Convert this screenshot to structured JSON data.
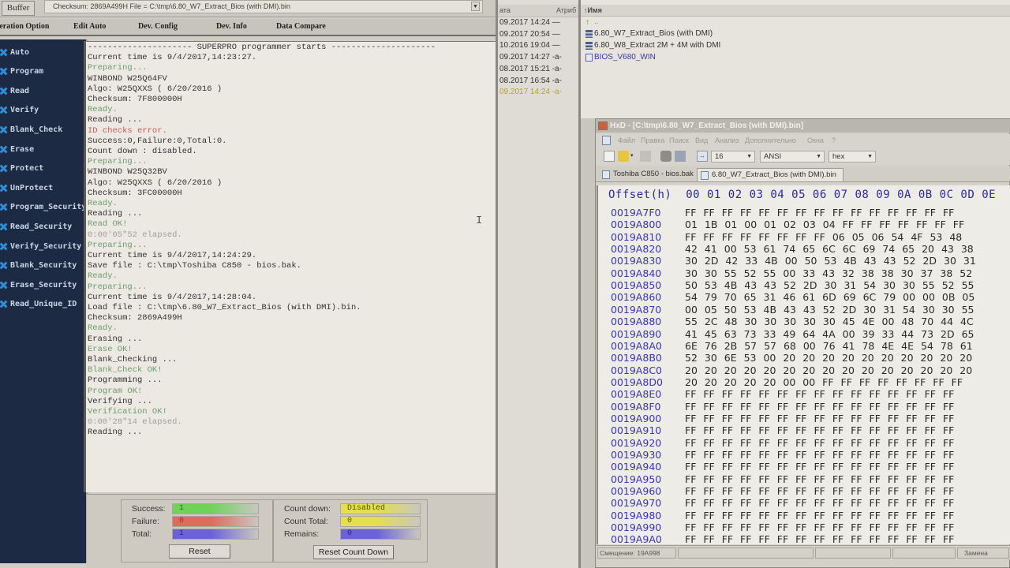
{
  "superpro": {
    "buffer_label": "Buffer",
    "info_combo": "Checksum: 2869A499H    File = C:\\tmp\\6.80_W7_Extract_Bios (with DMI).bin",
    "menu": [
      "Operation Option",
      "Edit Auto",
      "Dev. Config",
      "Dev. Info",
      "Data Compare"
    ],
    "operations": [
      "Auto",
      "Program",
      "Read",
      "Verify",
      "Blank_Check",
      "Erase",
      "Protect",
      "UnProtect",
      "Program_Security",
      "Read_Security",
      "Verify_Security",
      "Blank_Security",
      "Erase_Security",
      "Read_Unique_ID"
    ],
    "log": [
      {
        "text": "--------------------- SUPERPRO programmer starts ---------------------",
        "kind": "normal"
      },
      {
        "text": "Current time is 9/4/2017,14:23:27.",
        "kind": "normal"
      },
      {
        "text": "Preparing...",
        "kind": "ok"
      },
      {
        "text": "WINBOND W25Q64FV",
        "kind": "normal"
      },
      {
        "text": "Algo: W25QXXS   ( 6/20/2016 )",
        "kind": "normal"
      },
      {
        "text": "Checksum: 7F800000H",
        "kind": "normal"
      },
      {
        "text": "Ready.",
        "kind": "ok"
      },
      {
        "text": "Reading ...",
        "kind": "normal"
      },
      {
        "text": "ID checks error.",
        "kind": "err"
      },
      {
        "text": "Success:0,Failure:0,Total:0.",
        "kind": "normal"
      },
      {
        "text": "Count down : disabled.",
        "kind": "normal"
      },
      {
        "text": "Preparing...",
        "kind": "ok"
      },
      {
        "text": "WINBOND W25Q32BV",
        "kind": "normal"
      },
      {
        "text": "Algo: W25QXXS   ( 6/20/2016 )",
        "kind": "normal"
      },
      {
        "text": "Checksum: 3FC00000H",
        "kind": "normal"
      },
      {
        "text": "Ready.",
        "kind": "ok"
      },
      {
        "text": "Reading ...",
        "kind": "normal"
      },
      {
        "text": "Read OK!",
        "kind": "ok"
      },
      {
        "text": "0:00'05\"52 elapsed.",
        "kind": "dim"
      },
      {
        "text": "Preparing...",
        "kind": "ok"
      },
      {
        "text": "Current time is 9/4/2017,14:24:29.",
        "kind": "normal"
      },
      {
        "text": "Save file : C:\\tmp\\Toshiba C850 - bios.bak.",
        "kind": "normal"
      },
      {
        "text": "Ready.",
        "kind": "ok"
      },
      {
        "text": "Preparing...",
        "kind": "ok"
      },
      {
        "text": "Current time is 9/4/2017,14:28:04.",
        "kind": "normal"
      },
      {
        "text": "Load file : C:\\tmp\\6.80_W7_Extract_Bios (with DMI).bin.",
        "kind": "normal"
      },
      {
        "text": "Checksum: 2869A499H",
        "kind": "normal"
      },
      {
        "text": "Ready.",
        "kind": "ok"
      },
      {
        "text": "Erasing ...",
        "kind": "normal"
      },
      {
        "text": "Erase OK!",
        "kind": "ok"
      },
      {
        "text": "Blank_Checking ...",
        "kind": "normal"
      },
      {
        "text": "Blank_Check OK!",
        "kind": "ok"
      },
      {
        "text": "Programming ...",
        "kind": "normal"
      },
      {
        "text": "Program OK!",
        "kind": "ok"
      },
      {
        "text": "Verifying ...",
        "kind": "normal"
      },
      {
        "text": "Verification OK!",
        "kind": "ok"
      },
      {
        "text": "0:00'28\"14 elapsed.",
        "kind": "dim"
      },
      {
        "text": "Reading ...",
        "kind": "normal"
      }
    ],
    "stats": {
      "success_label": "Success:",
      "success_value": "1",
      "failure_label": "Failure:",
      "failure_value": "0",
      "total_label": "Total:",
      "total_value": "1",
      "reset_label": "Reset",
      "countdown_label": "Count down:",
      "countdown_value": "Disabled",
      "count_total_label": "Count Total:",
      "count_total_value": "0",
      "remains_label": "Remains:",
      "remains_value": "0",
      "reset_countdown_label": "Reset Count Down",
      "colors": {
        "success": "#6fd35a",
        "failure": "#e06a5c",
        "total": "#6a62d6",
        "countdown": "#e4df4a",
        "count_total": "#e4df4a",
        "remains": "#6a62d6"
      }
    }
  },
  "file_panel": {
    "col_date": "ата",
    "col_attr": "Атриб",
    "col_name": "↑Имя",
    "dates": [
      {
        "text": "09.2017 14:24 —",
        "hl": false
      },
      {
        "text": "09.2017 20:54 —",
        "hl": false
      },
      {
        "text": "10.2016 19:04 —",
        "hl": false
      },
      {
        "text": "09.2017 14:27 -a-",
        "hl": false
      },
      {
        "text": "08.2017 15:21 -a-",
        "hl": false
      },
      {
        "text": "08.2017 16:54 -a-",
        "hl": false
      },
      {
        "text": "09.2017 14:24 -a-",
        "hl": true
      }
    ],
    "files": [
      {
        "name": "..",
        "icon": "up-arrow"
      },
      {
        "name": "6.80_W7_Extract_Bios (with DMI)",
        "icon": "archive"
      },
      {
        "name": "6.80_W8_Extract 2M + 4M with DMI",
        "icon": "archive"
      },
      {
        "name": "BIOS_V680_WIN",
        "icon": "folder"
      }
    ]
  },
  "hxd": {
    "title": "HxD - [C:\\tmp\\6.80_W7_Extract_Bios (with DMI).bin]",
    "menu": [
      "Файл",
      "Правка",
      "Поиск",
      "Вид",
      "Анализ",
      "Дополнительно",
      "Окна",
      "?"
    ],
    "bytes_per_row": "16",
    "charset": "ANSI",
    "offset_base": "hex",
    "tabs": [
      "Toshiba C850 - bios.bak",
      "6.80_W7_Extract_Bios (with DMI).bin"
    ],
    "active_tab": 1,
    "header": "Offset(h)  00 01 02 03 04 05 06 07 08 09 0A 0B 0C 0D 0E",
    "rows": [
      {
        "offset": "0019A7F0",
        "bytes": "FF FF FF FF FF FF FF FF FF FF FF FF FF FF FF"
      },
      {
        "offset": "0019A800",
        "bytes": "01 1B 01 00 01 02 03 04 FF FF FF FF FF FF FF"
      },
      {
        "offset": "0019A810",
        "bytes": "FF FF FF FF FF FF FF FF 06 05 06 54 4F 53 48"
      },
      {
        "offset": "0019A820",
        "bytes": "42 41 00 53 61 74 65 6C 6C 69 74 65 20 43 38"
      },
      {
        "offset": "0019A830",
        "bytes": "30 2D 42 33 4B 00 50 53 4B 43 43 52 2D 30 31"
      },
      {
        "offset": "0019A840",
        "bytes": "30 30 55 52 55 00 33 43 32 38 38 30 37 38 52"
      },
      {
        "offset": "0019A850",
        "bytes": "50 53 4B 43 43 52 2D 30 31 54 30 30 55 52 55"
      },
      {
        "offset": "0019A860",
        "bytes": "54 79 70 65 31 46 61 6D 69 6C 79 00 00 0B 05"
      },
      {
        "offset": "0019A870",
        "bytes": "00 05 50 53 4B 43 43 52 2D 30 31 54 30 30 55"
      },
      {
        "offset": "0019A880",
        "bytes": "55 2C 48 30 30 30 30 30 45 4E 00 48 70 44 4C"
      },
      {
        "offset": "0019A890",
        "bytes": "41 45 63 73 33 49 64 4A 00 39 33 44 73 2D 65"
      },
      {
        "offset": "0019A8A0",
        "bytes": "6E 76 2B 57 57 68 00 76 41 78 4E 4E 54 78 61"
      },
      {
        "offset": "0019A8B0",
        "bytes": "52 30 6E 53 00 20 20 20 20 20 20 20 20 20 20"
      },
      {
        "offset": "0019A8C0",
        "bytes": "20 20 20 20 20 20 20 20 20 20 20 20 20 20 20"
      },
      {
        "offset": "0019A8D0",
        "bytes": "20 20 20 20 20 00 00 FF FF FF FF FF FF FF FF"
      },
      {
        "offset": "0019A8E0",
        "bytes": "FF FF FF FF FF FF FF FF FF FF FF FF FF FF FF"
      },
      {
        "offset": "0019A8F0",
        "bytes": "FF FF FF FF FF FF FF FF FF FF FF FF FF FF FF"
      },
      {
        "offset": "0019A900",
        "bytes": "FF FF FF FF FF FF FF FF FF FF FF FF FF FF FF"
      },
      {
        "offset": "0019A910",
        "bytes": "FF FF FF FF FF FF FF FF FF FF FF FF FF FF FF"
      },
      {
        "offset": "0019A920",
        "bytes": "FF FF FF FF FF FF FF FF FF FF FF FF FF FF FF"
      },
      {
        "offset": "0019A930",
        "bytes": "FF FF FF FF FF FF FF FF FF FF FF FF FF FF FF"
      },
      {
        "offset": "0019A940",
        "bytes": "FF FF FF FF FF FF FF FF FF FF FF FF FF FF FF"
      },
      {
        "offset": "0019A950",
        "bytes": "FF FF FF FF FF FF FF FF FF FF FF FF FF FF FF"
      },
      {
        "offset": "0019A960",
        "bytes": "FF FF FF FF FF FF FF FF FF FF FF FF FF FF FF"
      },
      {
        "offset": "0019A970",
        "bytes": "FF FF FF FF FF FF FF FF FF FF FF FF FF FF FF"
      },
      {
        "offset": "0019A980",
        "bytes": "FF FF FF FF FF FF FF FF FF FF FF FF FF FF FF"
      },
      {
        "offset": "0019A990",
        "bytes": "FF FF FF FF FF FF FF FF FF FF FF FF FF FF FF"
      },
      {
        "offset": "0019A9A0",
        "bytes": "FF FF FF FF FF FF FF FF FF FF FF FF FF FF FF"
      }
    ],
    "status_offset": "Смещение: 19A998",
    "status_mode": "Замена"
  }
}
